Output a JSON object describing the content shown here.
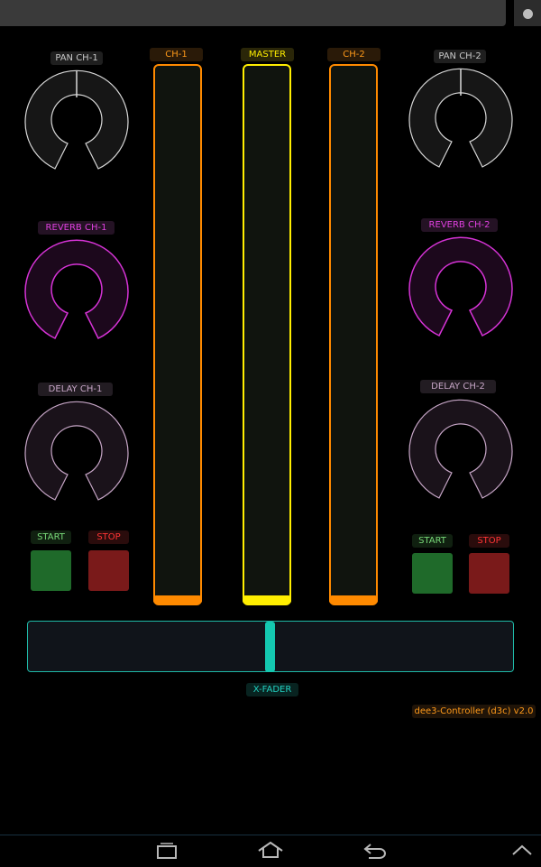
{
  "labels": {
    "pan_ch1": "PAN CH-1",
    "pan_ch2": "PAN CH-2",
    "reverb_ch1": "REVERB CH-1",
    "reverb_ch2": "REVERB CH-2",
    "delay_ch1": "DELAY CH-1",
    "delay_ch2": "DELAY CH-2",
    "ch1": "CH-1",
    "master": "MASTER",
    "ch2": "CH-2",
    "start1": "START",
    "stop1": "STOP",
    "start2": "START",
    "stop2": "STOP",
    "xfader": "X-FADER",
    "version": "dee3-Controller (d3c) v2.0"
  },
  "values": {
    "pan_ch1": 0.5,
    "pan_ch2": 0.5,
    "reverb_ch1": 0,
    "reverb_ch2": 0,
    "delay_ch1": 0,
    "delay_ch2": 0,
    "ch1_level": 0,
    "master_level": 0,
    "ch2_level": 0,
    "xfader": 0.5
  },
  "colors": {
    "pan": "#d8d8d8",
    "reverb": "#d633d6",
    "delay": "#c7a6c7",
    "channel": "#ff8a00",
    "master": "#ffee00",
    "xfader": "#1fb8a6"
  },
  "icons": {
    "menu": "overflow-dot-icon",
    "recent": "recent-apps-icon",
    "home": "home-icon",
    "back": "back-icon",
    "up": "chevron-up-icon"
  }
}
